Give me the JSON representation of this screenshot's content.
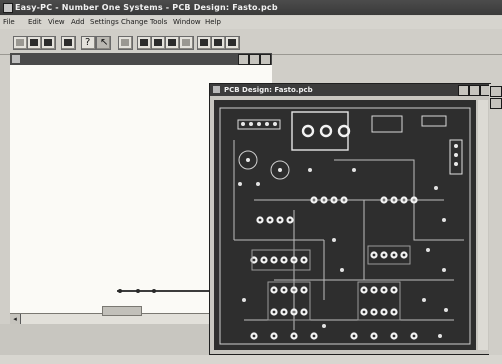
{
  "window": {
    "title": "Easy-PC - Number One Systems - PCB Design: Fasto.pcb"
  },
  "menu": {
    "items": [
      "File",
      "Edit",
      "View",
      "Add",
      "Settings",
      "Change",
      "Tools",
      "Window",
      "Help"
    ]
  },
  "toolbar": {
    "buttons": [
      "new",
      "open",
      "save",
      "zoom",
      "separator",
      "select",
      "grid",
      "pad",
      "track",
      "component",
      "text",
      "measure"
    ]
  },
  "pcb_window": {
    "title": "PCB Design: Fasto.pcb"
  },
  "colors": {
    "board": "#2e2e2e",
    "copper": "#e8e8e8",
    "titlebar": "#3c3c3c",
    "chrome": "#d0cec8"
  },
  "icons": {
    "app": "easy-pc-app-icon",
    "minimize": "minimize-icon",
    "maximize": "maximize-icon",
    "close": "close-icon"
  }
}
